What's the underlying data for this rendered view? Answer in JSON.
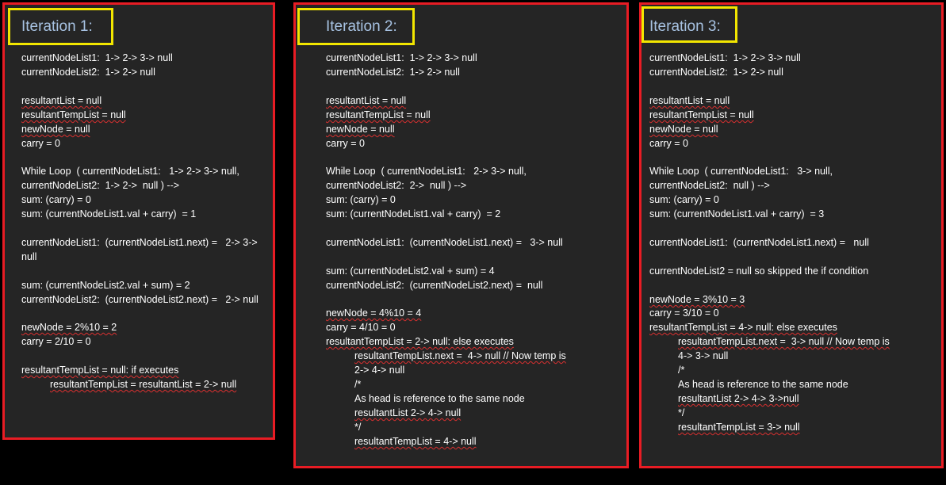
{
  "panels": [
    {
      "title": "Iteration 1:",
      "lines": [
        "currentNodeList1:  1-> 2-> 3-> null",
        "currentNodeList2:  1-> 2-> null",
        "resultantList = null",
        "resultantTempList = null",
        "newNode = null",
        "carry = 0",
        "While Loop  ( currentNodeList1:   1-> 2-> 3-> null,",
        "currentNodeList2:  1-> 2->  null ) -->",
        "sum: (carry) = 0",
        "sum: (currentNodeList1.val + carry)  = 1",
        "currentNodeList1:  (currentNodeList1.next) =   2-> 3->",
        "null",
        "sum: (currentNodeList2.val + sum) = 2",
        "currentNodeList2:  (currentNodeList2.next) =   2-> null",
        "newNode = 2%10 = 2",
        "carry = 2/10 = 0",
        "resultantTempList = null: if executes",
        "resultantTempList = resultantList = 2-> null"
      ]
    },
    {
      "title": "Iteration 2:",
      "lines": [
        "currentNodeList1:  1-> 2-> 3-> null",
        "currentNodeList2:  1-> 2-> null",
        "resultantList = null",
        "resultantTempList = null",
        "newNode = null",
        "carry = 0",
        "While Loop  ( currentNodeList1:   2-> 3-> null,",
        "currentNodeList2:  2->  null ) -->",
        "sum: (carry) = 0",
        "sum: (currentNodeList1.val + carry)  = 2",
        "currentNodeList1:  (currentNodeList1.next) =   3-> null",
        "sum: (currentNodeList2.val + sum) = 4",
        "currentNodeList2:  (currentNodeList2.next) =  null",
        "newNode = 4%10 = 4",
        "carry = 4/10 = 0",
        "resultantTempList = 2-> null: else executes",
        "resultantTempList.next =  4-> null // Now temp is",
        "2-> 4-> null",
        "/*",
        "As head is reference to the same node",
        "resultantList 2-> 4-> null",
        "*/",
        "resultantTempList = 4-> null"
      ]
    },
    {
      "title": "Iteration 3:",
      "lines": [
        "currentNodeList1:  1-> 2-> 3-> null",
        "currentNodeList2:  1-> 2-> null",
        "resultantList = null",
        "resultantTempList = null",
        "newNode = null",
        "carry = 0",
        "While Loop  ( currentNodeList1:   3-> null,",
        "currentNodeList2:  null ) -->",
        "sum: (carry) = 0",
        "sum: (currentNodeList1.val + carry)  = 3",
        "currentNodeList1:  (currentNodeList1.next) =   null",
        "currentNodeList2 = null so skipped the if condition",
        "newNode = 3%10 = 3",
        "carry = 3/10 = 0",
        "resultantTempList = 4-> null: else executes",
        "resultantTempList.next =  3-> null // Now temp is",
        "4-> 3-> null",
        "/*",
        "As head is reference to the same node",
        "resultantList 2-> 4-> 3->null",
        "*/",
        "resultantTempList = 3-> null"
      ]
    }
  ],
  "colors": {
    "background": "#000000",
    "panel": "#252525",
    "panel_border": "#e81c24",
    "title_border": "#f2e600",
    "title_text": "#a7c2e2",
    "body_text": "#ffffff",
    "spellcheck_underline": "#d93030"
  }
}
